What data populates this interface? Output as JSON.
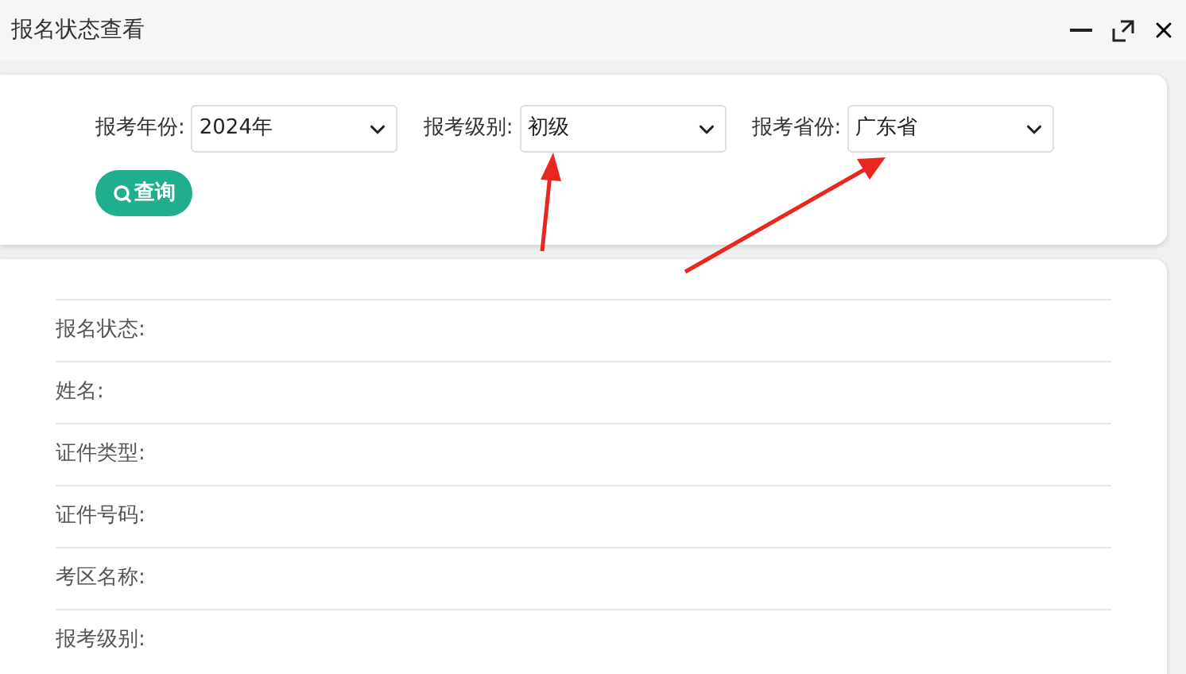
{
  "window": {
    "title": "报名状态查看"
  },
  "filters": [
    {
      "label": "报考年份:",
      "value": "2024年"
    },
    {
      "label": "报考级别:",
      "value": "初级"
    },
    {
      "label": "报考省份:",
      "value": "广东省"
    }
  ],
  "query_button": {
    "label": "查询"
  },
  "details": [
    {
      "label": "报名状态:"
    },
    {
      "label": "姓名:"
    },
    {
      "label": "证件类型:"
    },
    {
      "label": "证件号码:"
    },
    {
      "label": "考区名称:"
    },
    {
      "label": "报考级别:"
    }
  ]
}
